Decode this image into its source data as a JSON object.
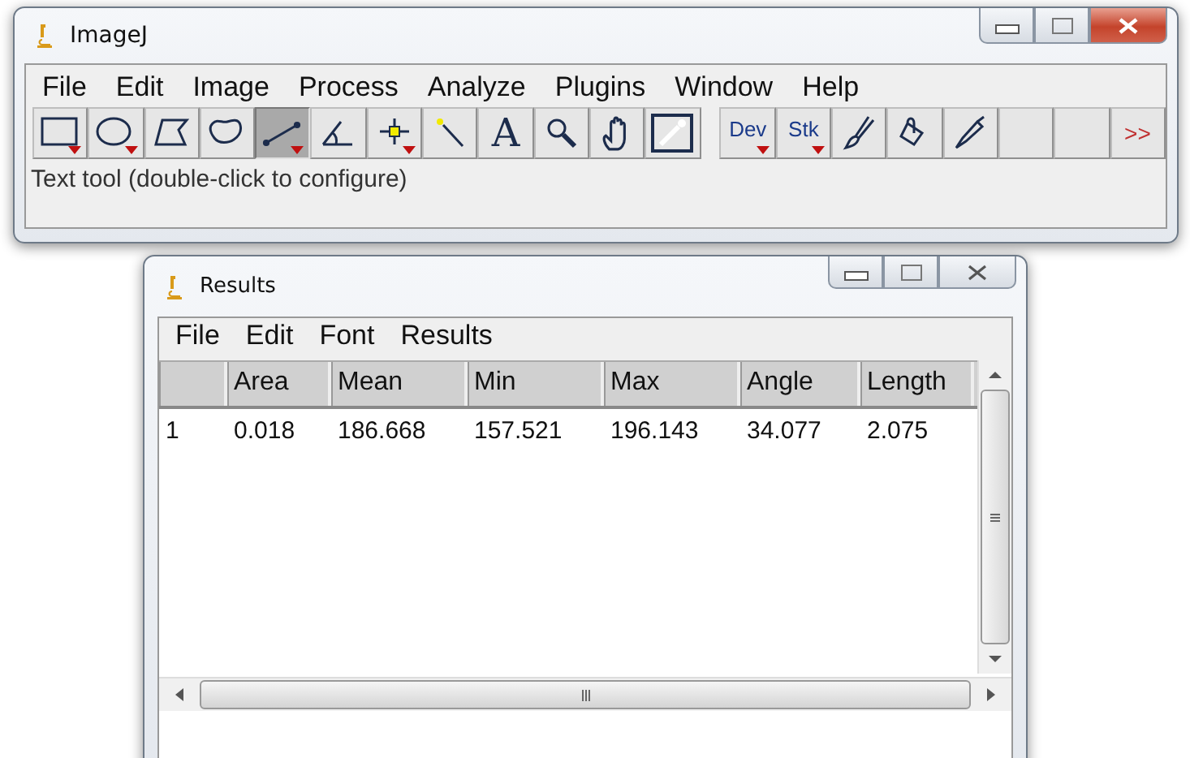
{
  "main_window": {
    "title": "ImageJ",
    "menu": [
      "File",
      "Edit",
      "Image",
      "Process",
      "Analyze",
      "Plugins",
      "Window",
      "Help"
    ],
    "tools": [
      {
        "kind": "icon",
        "selected": false,
        "has_menu": true
      },
      {
        "kind": "icon",
        "selected": false,
        "has_menu": true
      },
      {
        "kind": "icon",
        "selected": false,
        "has_menu": false
      },
      {
        "kind": "icon",
        "selected": false,
        "has_menu": false
      },
      {
        "kind": "icon",
        "selected": true,
        "has_menu": true
      },
      {
        "kind": "icon",
        "selected": false,
        "has_menu": false
      },
      {
        "kind": "icon",
        "selected": false,
        "has_menu": true
      },
      {
        "kind": "icon",
        "selected": false,
        "has_menu": false
      },
      {
        "kind": "text",
        "label": "A",
        "selected": false,
        "has_menu": false
      },
      {
        "kind": "icon",
        "selected": false,
        "has_menu": false
      },
      {
        "kind": "icon",
        "selected": false,
        "has_menu": false
      },
      {
        "kind": "icon",
        "selected": false,
        "has_menu": false
      },
      {
        "kind": "gap"
      },
      {
        "kind": "text",
        "label": "Dev",
        "selected": false,
        "has_menu": true
      },
      {
        "kind": "text",
        "label": "Stk",
        "selected": false,
        "has_menu": true
      },
      {
        "kind": "icon",
        "selected": false,
        "has_menu": false
      },
      {
        "kind": "icon",
        "selected": false,
        "has_menu": false
      },
      {
        "kind": "icon",
        "selected": false,
        "has_menu": false
      },
      {
        "kind": "empty"
      },
      {
        "kind": "empty"
      },
      {
        "kind": "more",
        "label": ">>",
        "selected": false,
        "has_menu": false
      }
    ],
    "status": "Text tool (double-click to configure)"
  },
  "results_window": {
    "title": "Results",
    "menu": [
      "File",
      "Edit",
      "Font",
      "Results"
    ],
    "table": {
      "columns": [
        "",
        "Area",
        "Mean",
        "Min",
        "Max",
        "Angle",
        "Length"
      ],
      "rows": [
        [
          "1",
          "0.018",
          "186.668",
          "157.521",
          "196.143",
          "34.077",
          "2.075"
        ]
      ]
    }
  }
}
